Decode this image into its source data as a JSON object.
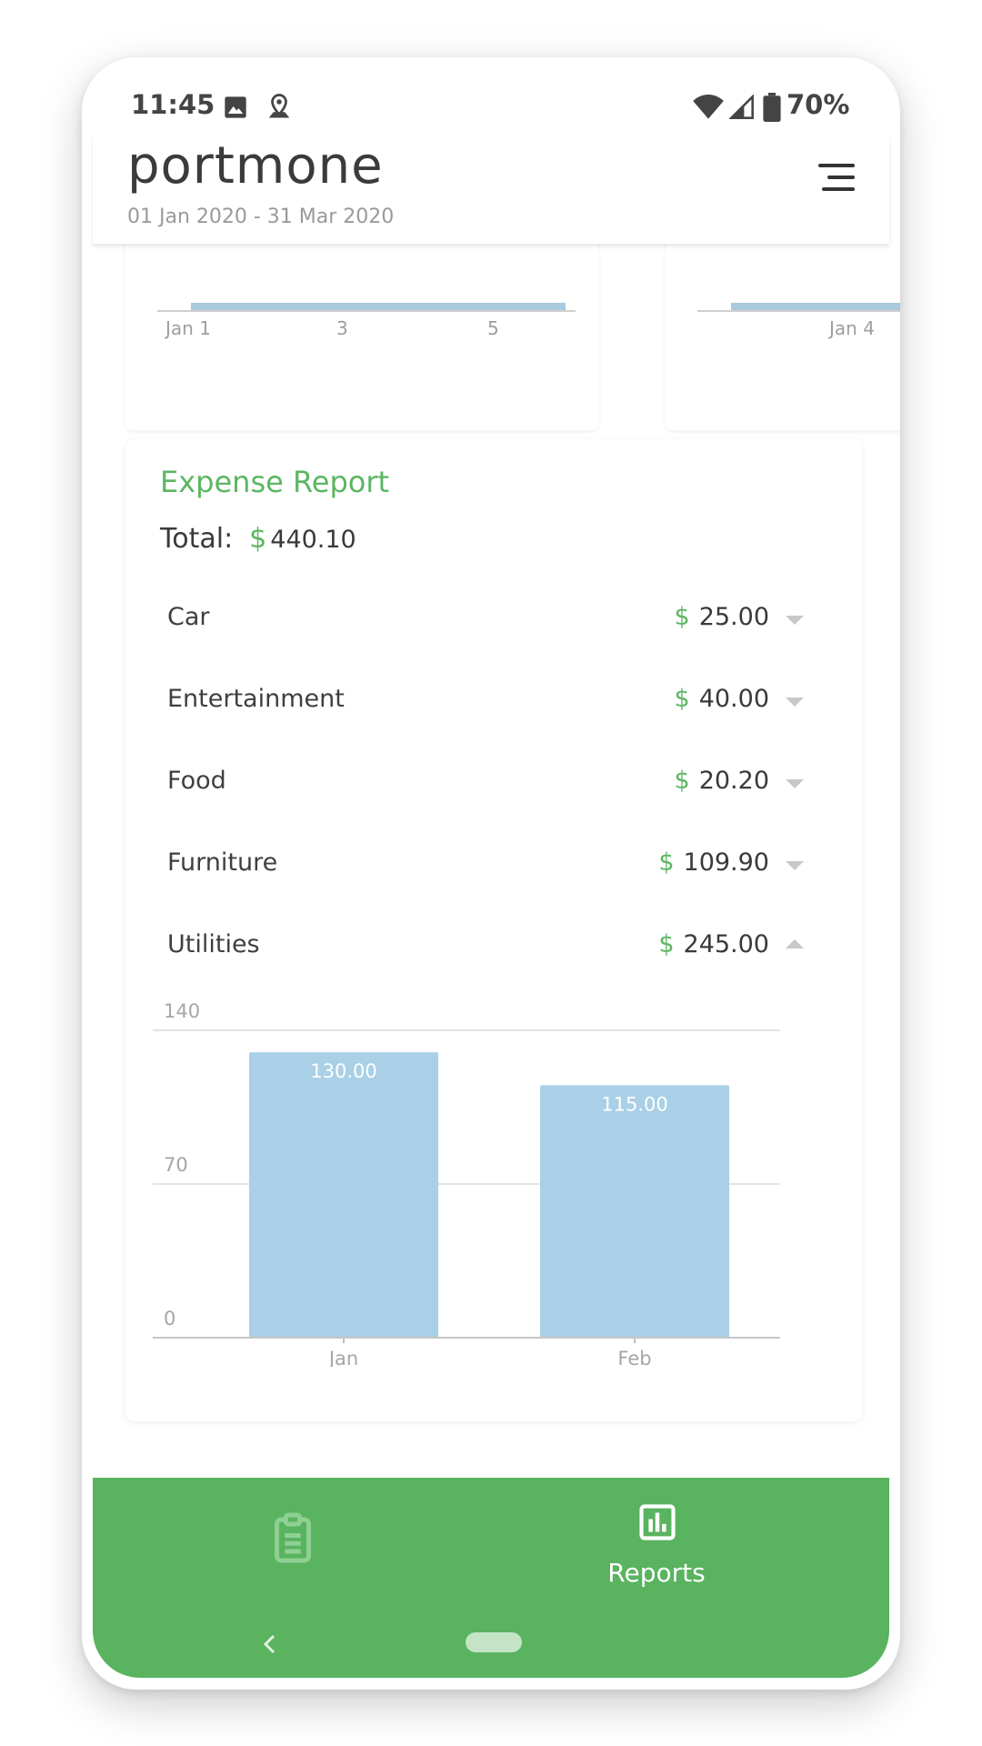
{
  "status_bar": {
    "time": "11:45",
    "battery": "70%",
    "icons": [
      "image-icon",
      "location-icon",
      "wifi-icon",
      "signal-icon",
      "battery-icon"
    ]
  },
  "app_bar": {
    "brand": "portmone",
    "date_range": "01 Jan 2020 - 31 Mar 2020",
    "menu_icon": "menu-icon"
  },
  "previous_cards": {
    "left_ticks": [
      "Jan 1",
      "3",
      "5"
    ],
    "right_ticks": [
      "Jan 4"
    ]
  },
  "expense_report": {
    "title": "Expense Report",
    "total_label": "Total:",
    "currency": "$",
    "total_value": "440.10",
    "categories": [
      {
        "label": "Car",
        "value": "25.00",
        "expanded": false
      },
      {
        "label": "Entertainment",
        "value": "40.00",
        "expanded": false
      },
      {
        "label": "Food",
        "value": "20.20",
        "expanded": false
      },
      {
        "label": "Furniture",
        "value": "109.90",
        "expanded": false
      },
      {
        "label": "Utilities",
        "value": "245.00",
        "expanded": true
      }
    ]
  },
  "chart_data": {
    "type": "bar",
    "categories": [
      "Jan",
      "Feb"
    ],
    "values": [
      130.0,
      115.0
    ],
    "value_labels": [
      "130.00",
      "115.00"
    ],
    "y_ticks": [
      "0",
      "70",
      "140"
    ],
    "ylim": [
      0,
      140
    ],
    "bar_color": "#a9d0e6",
    "grid": true
  },
  "bottom_nav": {
    "tabs": [
      {
        "icon": "clipboard-icon",
        "label": "",
        "active": false
      },
      {
        "icon": "bar-chart-icon",
        "label": "Reports",
        "active": true
      }
    ],
    "background": "#59b35f"
  },
  "colors": {
    "accent": "#5cb662",
    "bar": "#a9d0e6"
  }
}
